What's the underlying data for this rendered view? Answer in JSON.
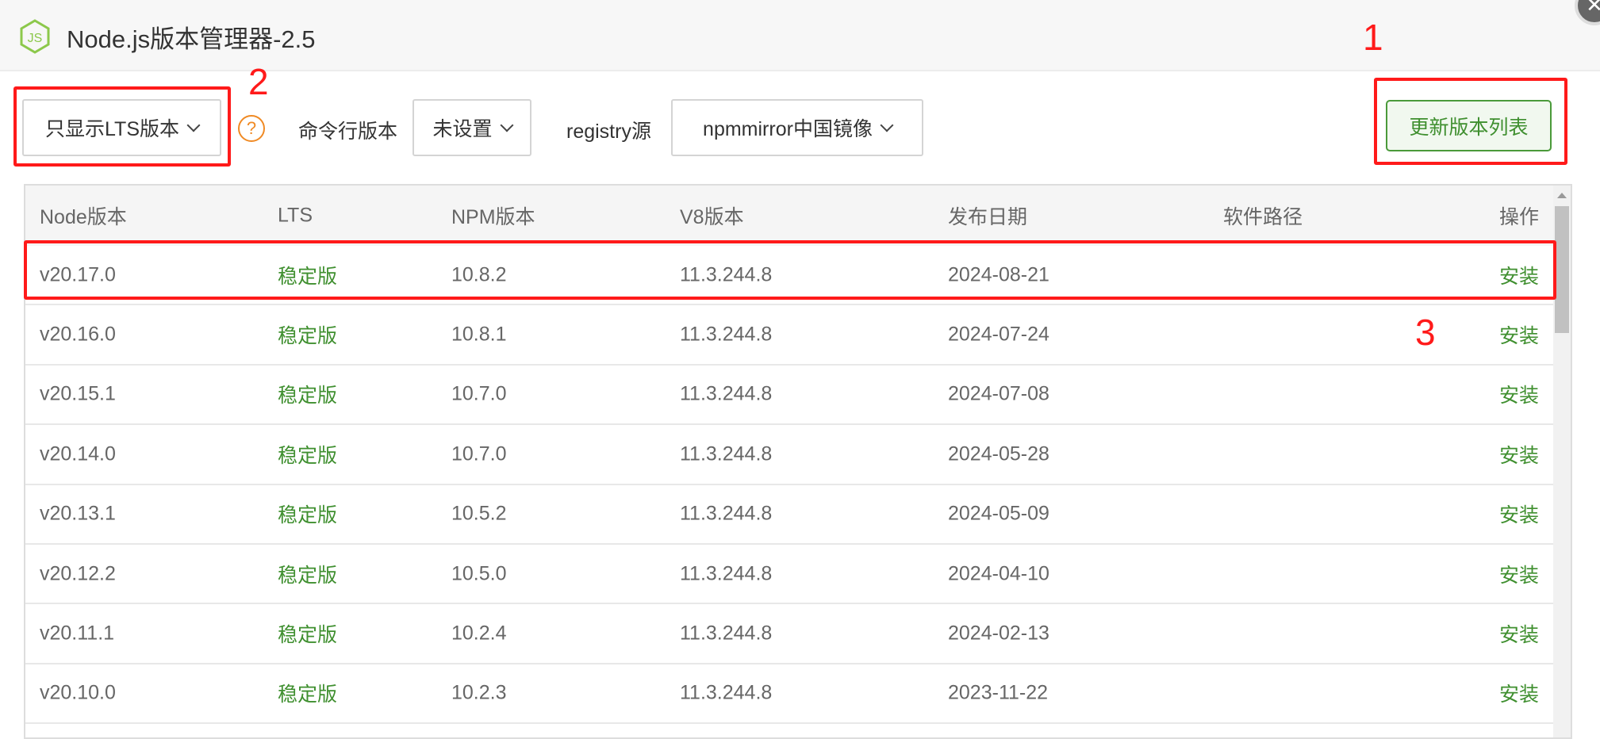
{
  "window": {
    "title": "Node.js版本管理器-2.5",
    "close_icon": "close-icon"
  },
  "toolbar": {
    "filter_select": "只显示LTS版本",
    "help": "?",
    "cli_label": "命令行版本",
    "cli_select": "未设置",
    "registry_label": "registry源",
    "registry_select": "npmmirror中国镜像",
    "update_button": "更新版本列表"
  },
  "annotations": {
    "one": "1",
    "two": "2",
    "three": "3"
  },
  "table": {
    "headers": [
      "Node版本",
      "LTS",
      "NPM版本",
      "V8版本",
      "发布日期",
      "软件路径",
      "操作"
    ],
    "rows": [
      {
        "node": "v20.17.0",
        "lts": "稳定版",
        "npm": "10.8.2",
        "v8": "11.3.244.8",
        "date": "2024-08-21",
        "path": "",
        "action": "安装"
      },
      {
        "node": "v20.16.0",
        "lts": "稳定版",
        "npm": "10.8.1",
        "v8": "11.3.244.8",
        "date": "2024-07-24",
        "path": "",
        "action": "安装"
      },
      {
        "node": "v20.15.1",
        "lts": "稳定版",
        "npm": "10.7.0",
        "v8": "11.3.244.8",
        "date": "2024-07-08",
        "path": "",
        "action": "安装"
      },
      {
        "node": "v20.14.0",
        "lts": "稳定版",
        "npm": "10.7.0",
        "v8": "11.3.244.8",
        "date": "2024-05-28",
        "path": "",
        "action": "安装"
      },
      {
        "node": "v20.13.1",
        "lts": "稳定版",
        "npm": "10.5.2",
        "v8": "11.3.244.8",
        "date": "2024-05-09",
        "path": "",
        "action": "安装"
      },
      {
        "node": "v20.12.2",
        "lts": "稳定版",
        "npm": "10.5.0",
        "v8": "11.3.244.8",
        "date": "2024-04-10",
        "path": "",
        "action": "安装"
      },
      {
        "node": "v20.11.1",
        "lts": "稳定版",
        "npm": "10.2.4",
        "v8": "11.3.244.8",
        "date": "2024-02-13",
        "path": "",
        "action": "安装"
      },
      {
        "node": "v20.10.0",
        "lts": "稳定版",
        "npm": "10.2.3",
        "v8": "11.3.244.8",
        "date": "2023-11-22",
        "path": "",
        "action": "安装"
      }
    ]
  },
  "colors": {
    "accent": "#3f8f2f",
    "annotation": "#ff1a1a",
    "help": "#f08a24"
  }
}
